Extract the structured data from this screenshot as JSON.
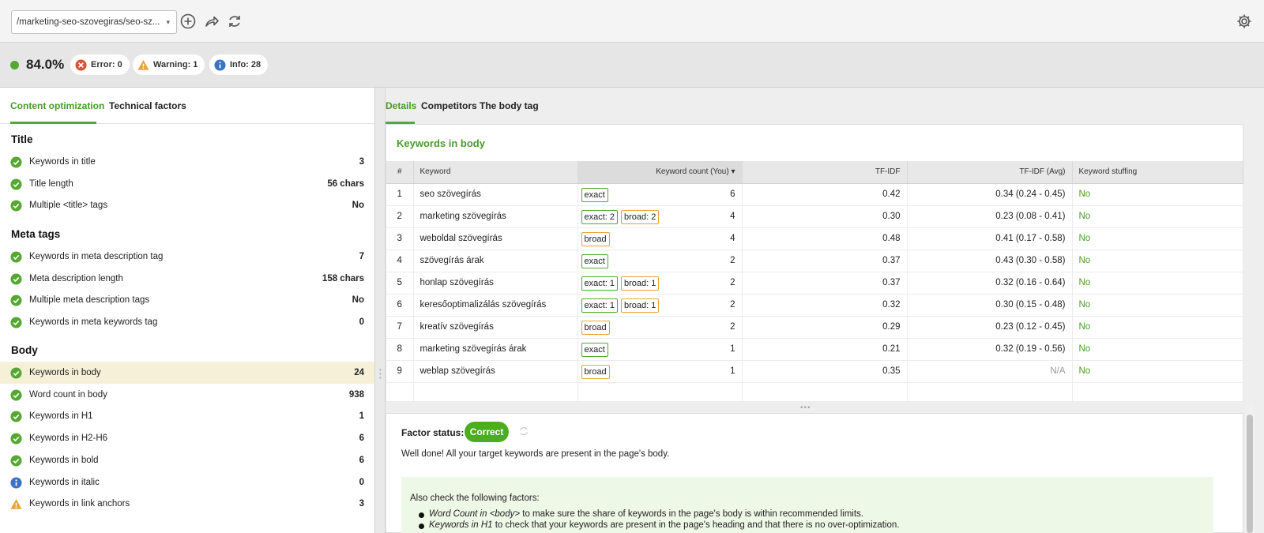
{
  "toolbar": {
    "url_value": "/marketing-seo-szovegiras/seo-sz...",
    "icons": [
      "add-icon",
      "share-icon",
      "refresh-icon",
      "gear-icon"
    ]
  },
  "score": {
    "value": "84.0%",
    "status_color": "#56a832",
    "error": "Error: 0",
    "warning": "Warning: 1",
    "info": "Info: 28"
  },
  "left_tabs": {
    "content": "Content optimization",
    "technical": "Technical factors"
  },
  "sections": {
    "title": {
      "heading": "Title",
      "rows": [
        {
          "label": "Keywords in title",
          "value": "3",
          "status": "ok"
        },
        {
          "label": "Title length",
          "value": "56 chars",
          "status": "ok"
        },
        {
          "label": "Multiple <title> tags",
          "value": "No",
          "status": "ok"
        }
      ]
    },
    "meta": {
      "heading": "Meta tags",
      "rows": [
        {
          "label": "Keywords in meta description tag",
          "value": "7",
          "status": "ok"
        },
        {
          "label": "Meta description length",
          "value": "158 chars",
          "status": "ok"
        },
        {
          "label": "Multiple meta description tags",
          "value": "No",
          "status": "ok"
        },
        {
          "label": "Keywords in meta keywords tag",
          "value": "0",
          "status": "ok"
        }
      ]
    },
    "body": {
      "heading": "Body",
      "rows": [
        {
          "label": "Keywords in body",
          "value": "24",
          "status": "ok"
        },
        {
          "label": "Word count in body",
          "value": "938",
          "status": "ok"
        },
        {
          "label": "Keywords in H1",
          "value": "1",
          "status": "ok"
        },
        {
          "label": "Keywords in H2-H6",
          "value": "6",
          "status": "ok"
        },
        {
          "label": "Keywords in bold",
          "value": "6",
          "status": "ok"
        },
        {
          "label": "Keywords in italic",
          "value": "0",
          "status": "info"
        },
        {
          "label": "Keywords in link anchors",
          "value": "3",
          "status": "warning"
        }
      ]
    }
  },
  "right_tabs": {
    "details": "Details",
    "competitors": "Competitors",
    "body_tag": "The body tag"
  },
  "card": {
    "title": "Keywords in body",
    "headers": [
      "#",
      "Keyword",
      "Keyword count (You)",
      "TF-IDF",
      "TF-IDF (Avg)",
      "Keyword stuffing"
    ],
    "rows": [
      {
        "n": "1",
        "keyword": "seo szövegírás",
        "tags": [
          "exact"
        ],
        "count": "6",
        "tfidf": "0.42",
        "avg": "0.34 (0.24 - 0.45)",
        "stuffing": "No"
      },
      {
        "n": "2",
        "keyword": "marketing szövegírás",
        "tags": [
          "exact: 2",
          "broad: 2"
        ],
        "count": "4",
        "tfidf": "0.30",
        "avg": "0.23 (0.08 - 0.41)",
        "stuffing": "No"
      },
      {
        "n": "3",
        "keyword": "weboldal szövegírás",
        "tags": [
          "broad"
        ],
        "count": "4",
        "tfidf": "0.48",
        "avg": "0.41 (0.17 - 0.58)",
        "stuffing": "No"
      },
      {
        "n": "4",
        "keyword": "szövegírás árak",
        "tags": [
          "exact"
        ],
        "count": "2",
        "tfidf": "0.37",
        "avg": "0.43 (0.30 - 0.58)",
        "stuffing": "No"
      },
      {
        "n": "5",
        "keyword": "honlap szövegírás",
        "tags": [
          "exact: 1",
          "broad: 1"
        ],
        "count": "2",
        "tfidf": "0.37",
        "avg": "0.32 (0.16 - 0.64)",
        "stuffing": "No"
      },
      {
        "n": "6",
        "keyword": "keresőoptimalizálás szövegírás",
        "tags": [
          "exact: 1",
          "broad: 1"
        ],
        "count": "2",
        "tfidf": "0.32",
        "avg": "0.30 (0.15 - 0.48)",
        "stuffing": "No"
      },
      {
        "n": "7",
        "keyword": "kreatív szövegírás",
        "tags": [
          "broad"
        ],
        "count": "2",
        "tfidf": "0.29",
        "avg": "0.23 (0.12 - 0.45)",
        "stuffing": "No"
      },
      {
        "n": "8",
        "keyword": "marketing szövegírás árak",
        "tags": [
          "exact"
        ],
        "count": "1",
        "tfidf": "0.21",
        "avg": "0.32 (0.19 - 0.56)",
        "stuffing": "No"
      },
      {
        "n": "9",
        "keyword": "weblap szövegírás",
        "tags": [
          "broad"
        ],
        "count": "1",
        "tfidf": "0.35",
        "avg": "N/A",
        "stuffing": "No"
      }
    ]
  },
  "factor": {
    "label": "Factor status:",
    "status": "Correct",
    "message": "Well done! All your target keywords are present in the page's body.",
    "also_title": "Also check the following factors:",
    "items": [
      {
        "em": "Word Count in <body>",
        "rest": " to make sure the share of keywords in the page's body is within recommended limits."
      },
      {
        "em": "Keywords in H1",
        "rest": " to check that your keywords are present in the page's heading and that there is no over-optimization."
      }
    ]
  },
  "colors": {
    "accent": "#4a9a2b",
    "ok": "#56a832",
    "warning": "#e8a23a",
    "error": "#d9553a",
    "info": "#3b73c4",
    "selected_row": "#f7f0d9"
  }
}
